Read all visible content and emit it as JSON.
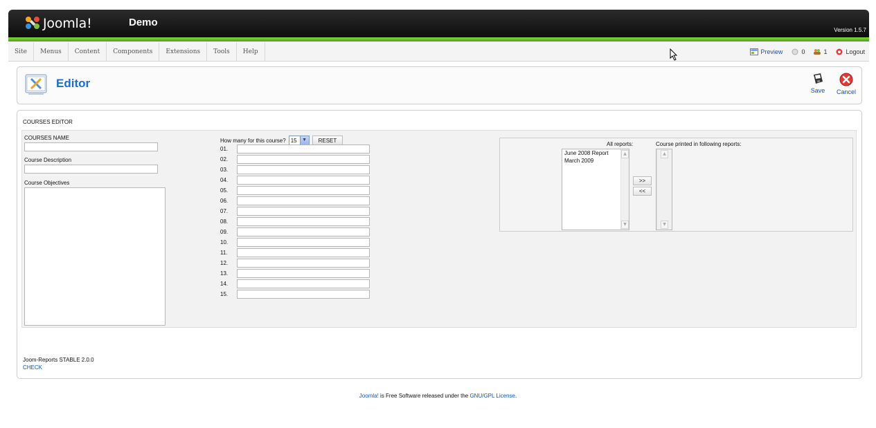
{
  "header": {
    "brand": "Joomla!",
    "site_title": "Demo",
    "version": "Version 1.5.7"
  },
  "menu": {
    "items": [
      "Site",
      "Menus",
      "Content",
      "Components",
      "Extensions",
      "Tools",
      "Help"
    ]
  },
  "status": {
    "preview": "Preview",
    "messages_count": "0",
    "users_count": "1",
    "logout": "Logout"
  },
  "toolbar": {
    "title": "Editor",
    "save_label": "Save",
    "cancel_label": "Cancel"
  },
  "editor": {
    "section_title": "COURSES EDITOR",
    "courses_name_label": "COURSES NAME",
    "courses_name_value": "",
    "description_label": "Course Description",
    "description_value": "",
    "objectives_label": "Course Objectives",
    "objectives_value": "",
    "how_many_label": "How many for this course?",
    "how_many_selected": "15",
    "reset_label": "RESET",
    "numbered_rows": [
      "01.",
      "02.",
      "03.",
      "04.",
      "05.",
      "06.",
      "07.",
      "08.",
      "09.",
      "10.",
      "11.",
      "12.",
      "13.",
      "14.",
      "15."
    ],
    "all_reports_label": "All reports:",
    "all_reports": [
      "June 2008 Report",
      "March 2009"
    ],
    "printed_reports_label": "Course printed in following reports:",
    "printed_reports": [],
    "add_button": ">>",
    "remove_button": "<<"
  },
  "footer": {
    "version_text": "Joom-Reports STABLE 2.0.0",
    "check_link": "CHECK",
    "credits_prefix": "Joomla!",
    "credits_middle": " is Free Software released under the ",
    "credits_link": "GNU/GPL License",
    "credits_suffix": "."
  },
  "colors": {
    "link_blue": "#0b55c4",
    "title_blue": "#1b6ccd",
    "header_green": "#62b82a"
  }
}
